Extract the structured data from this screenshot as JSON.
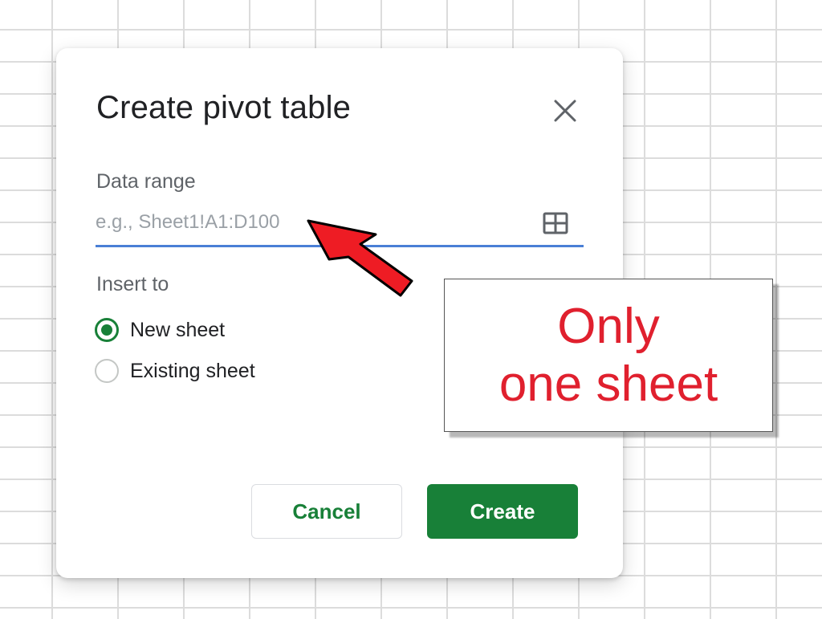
{
  "dialog": {
    "title": "Create pivot table",
    "close_icon": "close-icon",
    "data_range": {
      "label": "Data range",
      "placeholder": "e.g., Sheet1!A1:D100",
      "value": "",
      "select_icon": "grid-icon"
    },
    "insert_to": {
      "label": "Insert to",
      "options": [
        {
          "label": "New sheet",
          "selected": true
        },
        {
          "label": "Existing sheet",
          "selected": false
        }
      ]
    },
    "buttons": {
      "cancel": "Cancel",
      "create": "Create"
    }
  },
  "annotation": {
    "line1": "Only",
    "line2": "one sheet",
    "arrow_icon": "red-arrow-icon"
  },
  "colors": {
    "accent_green": "#188038",
    "focus_blue": "#4a7fd6",
    "annotation_red": "#e0202e",
    "arrow_red": "#ee1c24"
  }
}
